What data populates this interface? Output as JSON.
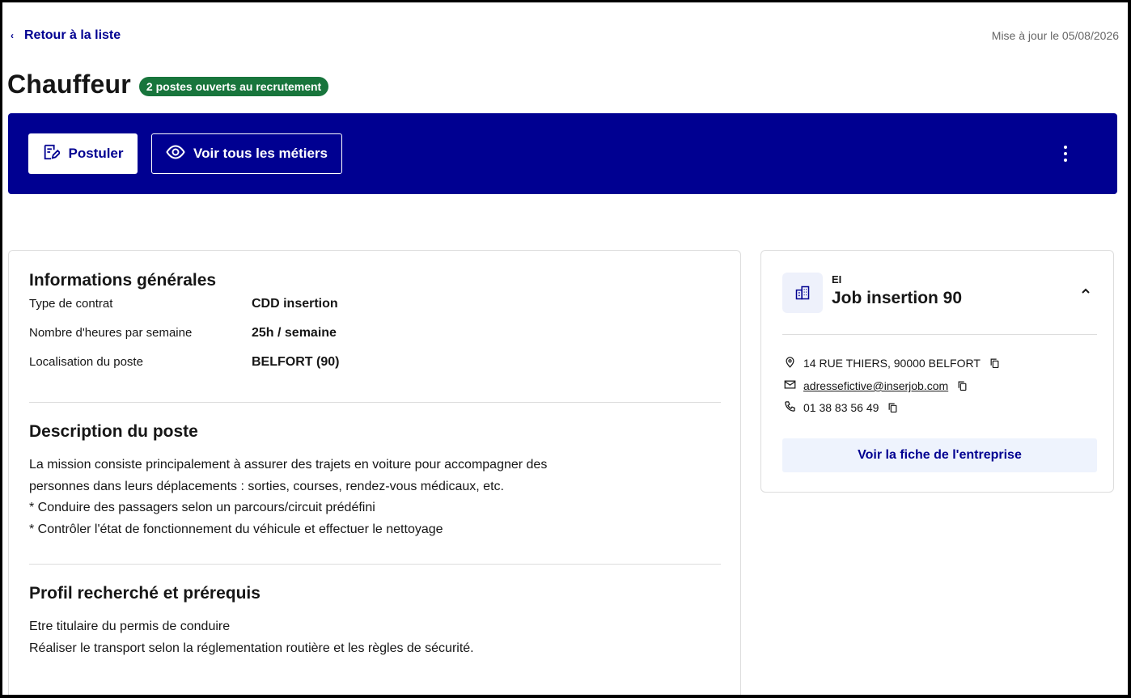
{
  "nav": {
    "back_label": "Retour à la liste",
    "updated_label": "Mise à jour le 05/08/2026"
  },
  "job": {
    "title": "Chauffeur",
    "badge": "2 postes ouverts au recrutement"
  },
  "actions": {
    "apply_label": "Postuler",
    "view_all_label": "Voir tous les métiers",
    "apply_icon": "edit-form-icon",
    "view_icon": "eye-icon",
    "more_icon": "more-vertical-icon"
  },
  "general": {
    "heading": "Informations générales",
    "rows": [
      {
        "label": "Type de contrat",
        "value": "CDD insertion"
      },
      {
        "label": "Nombre d'heures par semaine",
        "value": "25h / semaine"
      },
      {
        "label": "Localisation du poste",
        "value": "BELFORT (90)"
      }
    ]
  },
  "description": {
    "heading": "Description du poste",
    "lines": [
      "La mission consiste principalement à assurer des trajets en voiture pour accompagner des",
      "personnes dans leurs déplacements : sorties, courses, rendez-vous médicaux, etc.",
      "* Conduire des passagers selon un parcours/circuit prédéfini",
      "* Contrôler l'état de fonctionnement du véhicule et effectuer le nettoyage"
    ]
  },
  "profile": {
    "heading": "Profil recherché et prérequis",
    "lines": [
      "Etre titulaire du permis de conduire",
      "Réaliser le transport selon la réglementation routière et les règles de sécurité."
    ]
  },
  "company": {
    "type": "EI",
    "name": "Job insertion 90",
    "address": "14 RUE THIERS, 90000 BELFORT",
    "email": "adressefictive@inserjob.com",
    "phone": "01 38 83 56 49",
    "cta_label": "Voir la fiche de l'entreprise"
  },
  "colors": {
    "primary": "#000091",
    "success_badge": "#18753c",
    "secondary_bg": "#eef3fd"
  }
}
